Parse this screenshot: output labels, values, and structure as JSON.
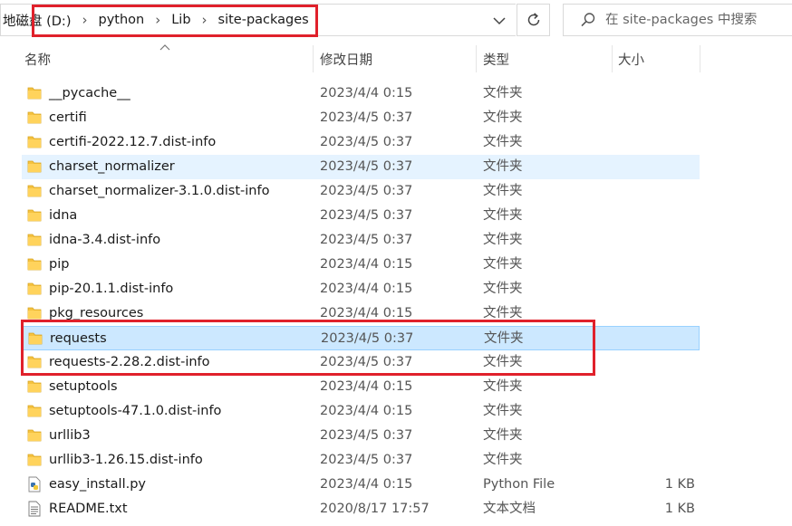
{
  "address": {
    "breadcrumbs": [
      "地磁盘 (D:)",
      "python",
      "Lib",
      "site-packages"
    ]
  },
  "search": {
    "placeholder": "在 site-packages 中搜索"
  },
  "columns": {
    "name": "名称",
    "date": "修改日期",
    "type": "类型",
    "size": "大小"
  },
  "files": [
    {
      "name": "__pycache__",
      "date": "2023/4/4 0:15",
      "type": "文件夹",
      "size": "",
      "icon": "folder-icon"
    },
    {
      "name": "certifi",
      "date": "2023/4/5 0:37",
      "type": "文件夹",
      "size": "",
      "icon": "folder-icon"
    },
    {
      "name": "certifi-2022.12.7.dist-info",
      "date": "2023/4/5 0:37",
      "type": "文件夹",
      "size": "",
      "icon": "folder-icon"
    },
    {
      "name": "charset_normalizer",
      "date": "2023/4/5 0:37",
      "type": "文件夹",
      "size": "",
      "icon": "folder-icon"
    },
    {
      "name": "charset_normalizer-3.1.0.dist-info",
      "date": "2023/4/5 0:37",
      "type": "文件夹",
      "size": "",
      "icon": "folder-icon"
    },
    {
      "name": "idna",
      "date": "2023/4/5 0:37",
      "type": "文件夹",
      "size": "",
      "icon": "folder-icon"
    },
    {
      "name": "idna-3.4.dist-info",
      "date": "2023/4/5 0:37",
      "type": "文件夹",
      "size": "",
      "icon": "folder-icon"
    },
    {
      "name": "pip",
      "date": "2023/4/4 0:15",
      "type": "文件夹",
      "size": "",
      "icon": "folder-icon"
    },
    {
      "name": "pip-20.1.1.dist-info",
      "date": "2023/4/4 0:15",
      "type": "文件夹",
      "size": "",
      "icon": "folder-icon"
    },
    {
      "name": "pkg_resources",
      "date": "2023/4/4 0:15",
      "type": "文件夹",
      "size": "",
      "icon": "folder-icon"
    },
    {
      "name": "requests",
      "date": "2023/4/5 0:37",
      "type": "文件夹",
      "size": "",
      "icon": "folder-icon"
    },
    {
      "name": "requests-2.28.2.dist-info",
      "date": "2023/4/5 0:37",
      "type": "文件夹",
      "size": "",
      "icon": "folder-icon"
    },
    {
      "name": "setuptools",
      "date": "2023/4/4 0:15",
      "type": "文件夹",
      "size": "",
      "icon": "folder-icon"
    },
    {
      "name": "setuptools-47.1.0.dist-info",
      "date": "2023/4/4 0:15",
      "type": "文件夹",
      "size": "",
      "icon": "folder-icon"
    },
    {
      "name": "urllib3",
      "date": "2023/4/5 0:37",
      "type": "文件夹",
      "size": "",
      "icon": "folder-icon"
    },
    {
      "name": "urllib3-1.26.15.dist-info",
      "date": "2023/4/5 0:37",
      "type": "文件夹",
      "size": "",
      "icon": "folder-icon"
    },
    {
      "name": "easy_install.py",
      "date": "2023/4/4 0:15",
      "type": "Python File",
      "size": "1 KB",
      "icon": "python-file-icon"
    },
    {
      "name": "README.txt",
      "date": "2020/8/17 17:57",
      "type": "文本文档",
      "size": "1 KB",
      "icon": "text-file-icon"
    }
  ],
  "colors": {
    "folder": "#f5c240",
    "highlight_border": "#e0212b",
    "hover_row": "#e5f3ff",
    "selected_row": "#cce8ff"
  }
}
